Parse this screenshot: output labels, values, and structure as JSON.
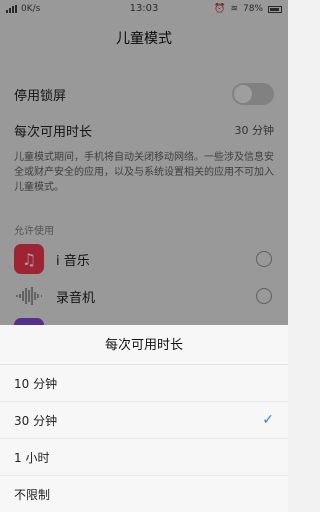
{
  "status_bar": {
    "speed": "0K/s",
    "time": "13:03",
    "battery": "78%"
  },
  "title": "儿童模式",
  "settings": {
    "disable_lock": {
      "label": "停用锁屏",
      "enabled": false
    },
    "time_limit": {
      "label": "每次可用时长",
      "value": "30 分钟"
    }
  },
  "description": "儿童模式期间，手机将自动关闭移动网络。一些涉及信息安全或财产安全的应用，以及与系统设置相关的应用不可加入儿童模式。",
  "allowed_section_label": "允许使用",
  "apps": [
    {
      "name": "i 音乐",
      "icon": "music-icon",
      "color": "#ff3a55",
      "selected": false
    },
    {
      "name": "录音机",
      "icon": "waveform-icon",
      "color": "#9a9a9a",
      "selected": false
    }
  ],
  "sheet": {
    "title": "每次可用时长",
    "options": [
      {
        "label": "10 分钟",
        "selected": false
      },
      {
        "label": "30 分钟",
        "selected": true
      },
      {
        "label": "1 小时",
        "selected": false
      },
      {
        "label": "不限制",
        "selected": false
      }
    ]
  },
  "colors": {
    "accent": "#2f80ed",
    "overlay": "rgba(0,0,0,0.38)"
  }
}
